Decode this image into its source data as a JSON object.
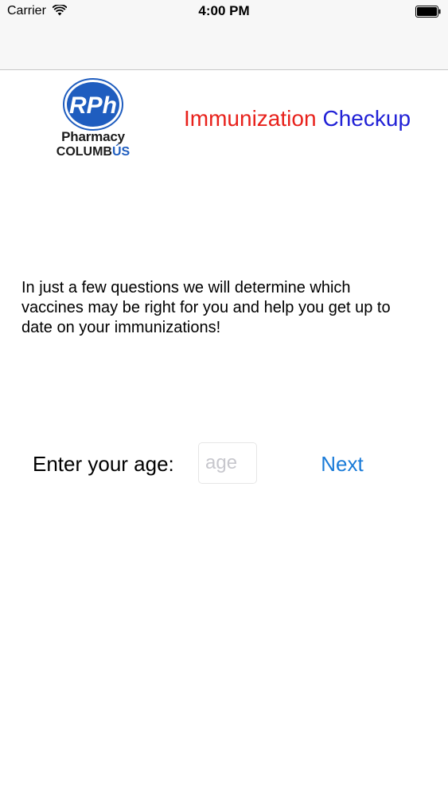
{
  "status_bar": {
    "carrier": "Carrier",
    "time": "4:00 PM",
    "icons": [
      "wifi-icon",
      "battery-icon"
    ]
  },
  "logo": {
    "badge_text": "RPh",
    "name": "Pharmacy",
    "city_main": "COLUMB",
    "city_accent": "ÚS",
    "colors": {
      "badge": "#1f5dbf",
      "text": "#1b1b1b"
    }
  },
  "title": {
    "part1": "Immunization",
    "part2": "Checkup",
    "colors": {
      "part1": "#e8211b",
      "part2": "#2121d6"
    }
  },
  "intro": {
    "text": "In just a few questions we will determine which vaccines may be right for you and help you get up to date on your immunizations!"
  },
  "age_form": {
    "label": "Enter your age:",
    "placeholder": "age",
    "value": "",
    "next_label": "Next",
    "accent_color": "#1a7bd8"
  }
}
